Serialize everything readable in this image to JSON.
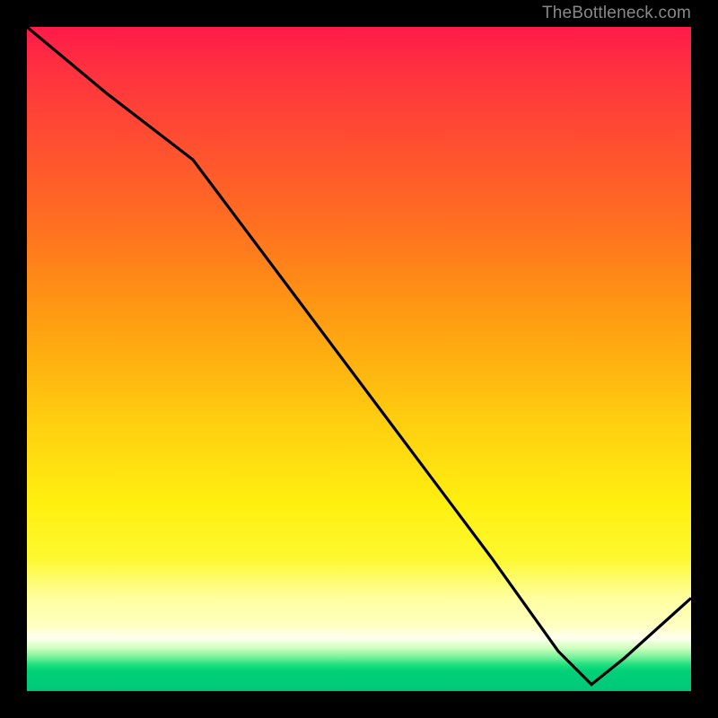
{
  "watermark": "TheBottleneck.com",
  "bottom_label": "",
  "colors": {
    "line": "#000000",
    "label": "#d03030"
  },
  "chart_data": {
    "type": "line",
    "title": "",
    "xlabel": "",
    "ylabel": "",
    "xlim": [
      0,
      100
    ],
    "ylim": [
      0,
      100
    ],
    "x": [
      0,
      12,
      25,
      40,
      55,
      70,
      80,
      85,
      90,
      100
    ],
    "values": [
      100,
      90,
      80,
      60,
      40,
      20,
      6,
      1,
      5,
      14
    ],
    "optimum_x": 84
  }
}
